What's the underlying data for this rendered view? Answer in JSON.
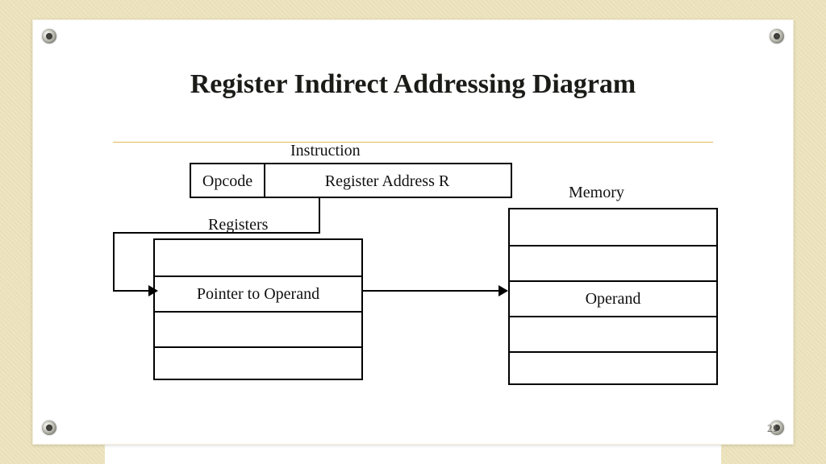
{
  "title": "Register Indirect Addressing Diagram",
  "page_number": "21",
  "instruction": {
    "label": "Instruction",
    "opcode": "Opcode",
    "register_address": "Register Address R"
  },
  "registers": {
    "label": "Registers",
    "rows": [
      "",
      "Pointer to Operand",
      "",
      ""
    ]
  },
  "memory": {
    "label": "Memory",
    "rows": [
      "",
      "",
      "Operand",
      "",
      ""
    ]
  },
  "icons": {
    "corner_screw": "eyelet-icon"
  }
}
